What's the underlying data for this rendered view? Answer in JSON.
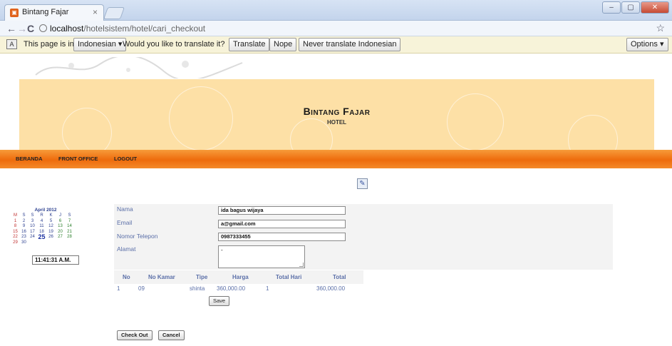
{
  "browser": {
    "tab_title": "Bintang Fajar",
    "tab_close": "×",
    "url_host": "localhost",
    "url_path": "/hotelsistem/hotel/cari_checkout",
    "window_buttons": [
      "–",
      "▢",
      "✕"
    ]
  },
  "infobar": {
    "prefix": "This page is in",
    "language": "Indonesian ▾",
    "question": "Would you like to translate it?",
    "translate": "Translate",
    "nope": "Nope",
    "never": "Never translate Indonesian",
    "options": "Options ▾"
  },
  "site": {
    "title": "Bintang Fajar",
    "subtitle": "HOTEL"
  },
  "menu": [
    "BERANDA",
    "FRONT OFFICE",
    "LOGOUT"
  ],
  "calendar": {
    "title": "April 2012",
    "weekdays": [
      "M",
      "S",
      "S",
      "R",
      "K",
      "J",
      "S"
    ],
    "weeks": [
      [
        "1",
        "2",
        "3",
        "4",
        "5",
        "6",
        "7"
      ],
      [
        "8",
        "9",
        "10",
        "11",
        "12",
        "13",
        "14"
      ],
      [
        "15",
        "16",
        "17",
        "18",
        "19",
        "20",
        "21"
      ],
      [
        "22",
        "23",
        "24",
        "25",
        "26",
        "27",
        "28"
      ],
      [
        "29",
        "30",
        "",
        "",
        "",
        "",
        ""
      ]
    ],
    "today": "25",
    "clock": "11:41:31 A.M."
  },
  "form": {
    "nama_label": "Nama",
    "nama_value": "ida bagus wijaya",
    "email_label": "Email",
    "email_value": "a@gmail.com",
    "telp_label": "Nomor Telepon",
    "telp_value": "0987333455",
    "alamat_label": "Alamat",
    "alamat_value": "-"
  },
  "table": {
    "headers": [
      "No",
      "No Kamar",
      "Tipe",
      "Harga",
      "Total Hari",
      "Total"
    ],
    "row": [
      "1",
      "09",
      "shinta",
      "360,000.00",
      "1",
      "360,000.00"
    ]
  },
  "buttons": {
    "save": "Save",
    "checkout": "Check Out",
    "cancel": "Cancel"
  }
}
